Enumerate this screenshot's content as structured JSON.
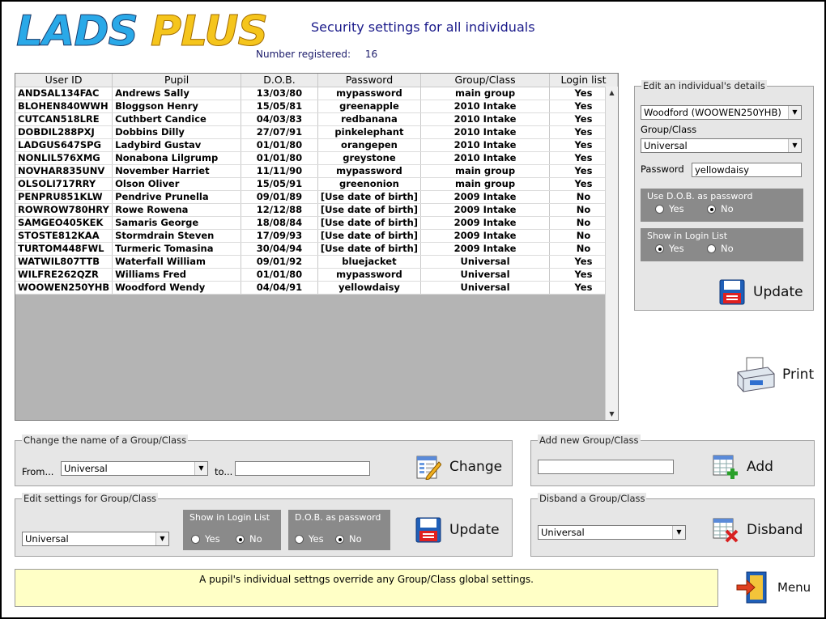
{
  "logo": {
    "word1": "LADS",
    "word2": "PLUS"
  },
  "title": "Security settings for all individuals",
  "registered": {
    "label": "Number registered:",
    "count": "16"
  },
  "grid": {
    "columns": [
      "User ID",
      "Pupil",
      "D.O.B.",
      "Password",
      "Group/Class",
      "Login list"
    ],
    "rows": [
      [
        "ANDSAL134FAC",
        "Andrews Sally",
        "13/03/80",
        "mypassword",
        "main group",
        "Yes"
      ],
      [
        "BLOHEN840WWH",
        "Bloggson Henry",
        "15/05/81",
        "greenapple",
        "2010 Intake",
        "Yes"
      ],
      [
        "CUTCAN518LRE",
        "Cuthbert Candice",
        "04/03/83",
        "redbanana",
        "2010 Intake",
        "Yes"
      ],
      [
        "DOBDIL288PXJ",
        "Dobbins Dilly",
        "27/07/91",
        "pinkelephant",
        "2010 Intake",
        "Yes"
      ],
      [
        "LADGUS647SPG",
        "Ladybird Gustav",
        "01/01/80",
        "orangepen",
        "2010 Intake",
        "Yes"
      ],
      [
        "NONLIL576XMG",
        "Nonabona Lilgrump",
        "01/01/80",
        "greystone",
        "2010 Intake",
        "Yes"
      ],
      [
        "NOVHAR835UNV",
        "November Harriet",
        "11/11/90",
        "mypassword",
        "main group",
        "Yes"
      ],
      [
        "OLSOLI717RRY",
        "Olson Oliver",
        "15/05/91",
        "greenonion",
        "main group",
        "Yes"
      ],
      [
        "PENPRU851KLW",
        "Pendrive Prunella",
        "09/01/89",
        "[Use date of birth]",
        "2009 Intake",
        "No"
      ],
      [
        "ROWROW780HRY",
        "Rowe Rowena",
        "12/12/88",
        "[Use date of birth]",
        "2009 Intake",
        "No"
      ],
      [
        "SAMGEO405KEK",
        "Samaris George",
        "18/08/84",
        "[Use date of birth]",
        "2009 Intake",
        "No"
      ],
      [
        "STOSTE812KAA",
        "Stormdrain Steven",
        "17/09/93",
        "[Use date of birth]",
        "2009 Intake",
        "No"
      ],
      [
        "TURTOM448FWL",
        "Turmeric Tomasina",
        "30/04/94",
        "[Use date of birth]",
        "2009 Intake",
        "No"
      ],
      [
        "WATWIL807TTB",
        "Waterfall William",
        "09/01/92",
        "bluejacket",
        "Universal",
        "Yes"
      ],
      [
        "WILFRE262QZR",
        "Williams Fred",
        "01/01/80",
        "mypassword",
        "Universal",
        "Yes"
      ],
      [
        "WOOWEN250YHB",
        "Woodford Wendy",
        "04/04/91",
        "yellowdaisy",
        "Universal",
        "Yes"
      ]
    ]
  },
  "edit_individual": {
    "legend": "Edit an individual's details",
    "selected": "Woodford (WOOWEN250YHB)",
    "group_label": "Group/Class",
    "group_value": "Universal",
    "password_label": "Password",
    "password_value": "yellowdaisy",
    "dob_title": "Use D.O.B. as password",
    "dob_yes": "Yes",
    "dob_no": "No",
    "dob_selected": "No",
    "login_title": "Show in Login List",
    "login_yes": "Yes",
    "login_no": "No",
    "login_selected": "Yes",
    "update": "Update"
  },
  "print": "Print",
  "change_group": {
    "legend": "Change the name of a Group/Class",
    "from_label": "From...",
    "from_value": "Universal",
    "to_label": "to...",
    "to_value": "",
    "button": "Change"
  },
  "add_group": {
    "legend": "Add new Group/Class",
    "value": "",
    "button": "Add"
  },
  "edit_group": {
    "legend": "Edit settings for Group/Class",
    "value": "Universal",
    "login_title": "Show in Login List",
    "login_yes": "Yes",
    "login_no": "No",
    "login_selected": "No",
    "dob_title": "D.O.B. as password",
    "dob_yes": "Yes",
    "dob_no": "No",
    "dob_selected": "No",
    "button": "Update"
  },
  "disband_group": {
    "legend": "Disband a Group/Class",
    "value": "Universal",
    "button": "Disband"
  },
  "note": "A pupil's individual settngs override any Group/Class global settings.",
  "menu": "Menu",
  "colors": {
    "title": "#1a1a8a",
    "note_bg": "#ffffc6",
    "panel_bg": "#e6e6e6",
    "grid_bg": "#b4b4b4"
  }
}
